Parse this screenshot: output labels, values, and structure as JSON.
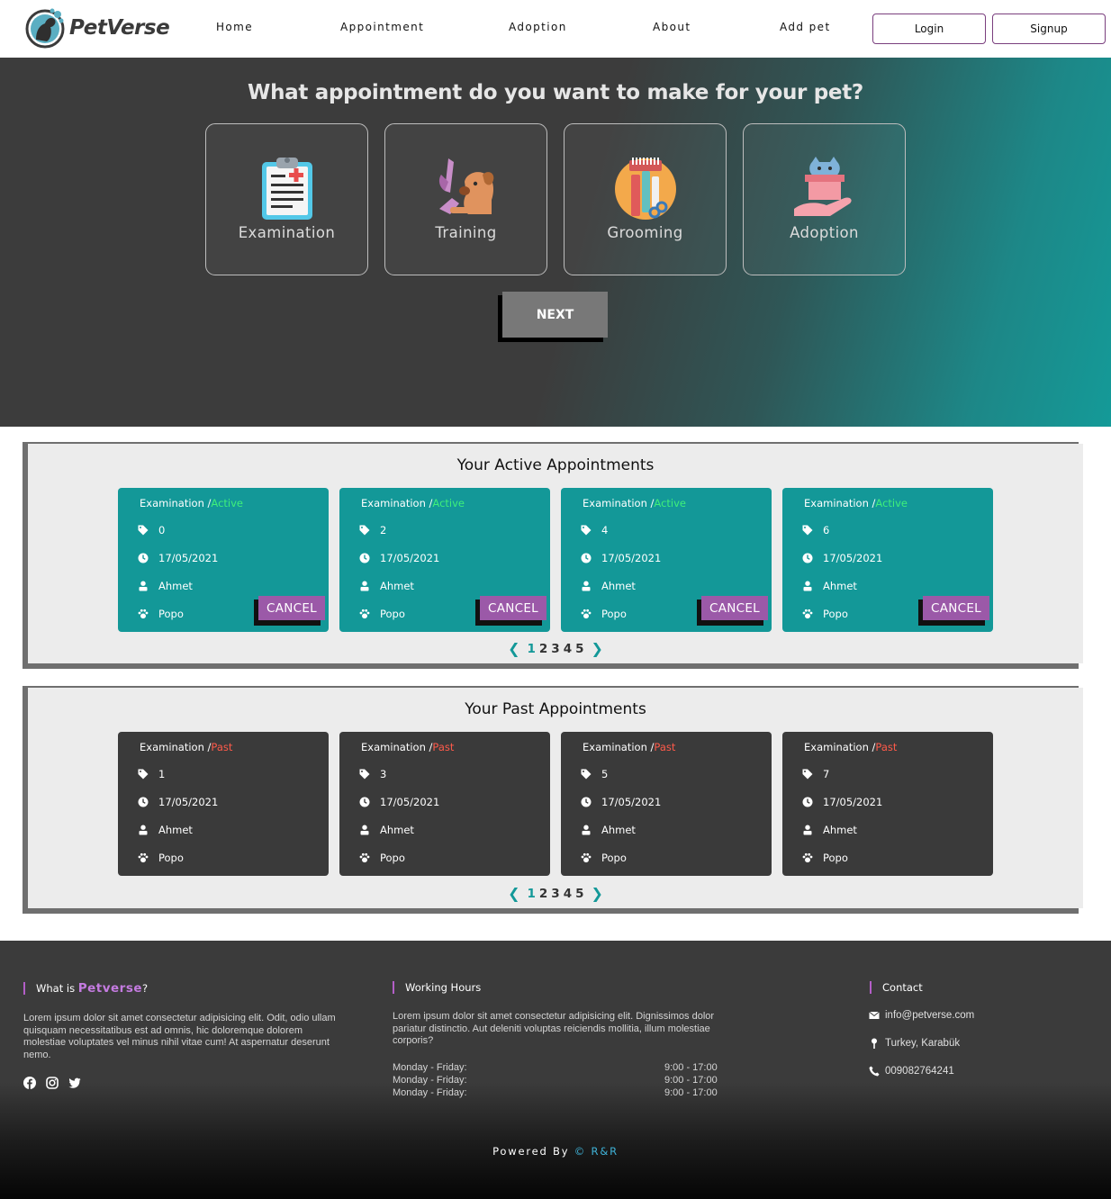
{
  "nav": {
    "brand": "PetVerse",
    "links": [
      "Home",
      "Appointment",
      "Adoption",
      "About",
      "Add pet"
    ],
    "login_label": "Login",
    "signup_label": "Signup"
  },
  "hero": {
    "title": "What appointment do you want to make for your pet?",
    "options": [
      {
        "label": "Examination",
        "icon": "clipboard-medical-icon"
      },
      {
        "label": "Training",
        "icon": "dog-training-icon"
      },
      {
        "label": "Grooming",
        "icon": "grooming-tools-icon"
      },
      {
        "label": "Adoption",
        "icon": "cat-box-hand-icon"
      }
    ],
    "next_label": "NEXT"
  },
  "active_section": {
    "title": "Your Active Appointments",
    "status_label": "Active",
    "cancel_label": "CANCEL",
    "cards": [
      {
        "type": "Examination /",
        "id": "0",
        "date": "17/05/2021",
        "owner": "Ahmet",
        "pet": "Popo"
      },
      {
        "type": "Examination /",
        "id": "2",
        "date": "17/05/2021",
        "owner": "Ahmet",
        "pet": "Popo"
      },
      {
        "type": "Examination /",
        "id": "4",
        "date": "17/05/2021",
        "owner": "Ahmet",
        "pet": "Popo"
      },
      {
        "type": "Examination /",
        "id": "6",
        "date": "17/05/2021",
        "owner": "Ahmet",
        "pet": "Popo"
      }
    ],
    "pages": [
      "1",
      "2",
      "3",
      "4",
      "5"
    ],
    "current_page": "1"
  },
  "past_section": {
    "title": "Your Past Appointments",
    "status_label": "Past",
    "cards": [
      {
        "type": "Examination /",
        "id": "1",
        "date": "17/05/2021",
        "owner": "Ahmet",
        "pet": "Popo"
      },
      {
        "type": "Examination /",
        "id": "3",
        "date": "17/05/2021",
        "owner": "Ahmet",
        "pet": "Popo"
      },
      {
        "type": "Examination /",
        "id": "5",
        "date": "17/05/2021",
        "owner": "Ahmet",
        "pet": "Popo"
      },
      {
        "type": "Examination /",
        "id": "7",
        "date": "17/05/2021",
        "owner": "Ahmet",
        "pet": "Popo"
      }
    ],
    "pages": [
      "1",
      "2",
      "3",
      "4",
      "5"
    ],
    "current_page": "1"
  },
  "footer": {
    "about_heading_prefix": "What is",
    "about_heading_brand": "Petverse",
    "about_heading_suffix": "?",
    "about_text": "Lorem ipsum dolor sit amet consectetur adipisicing elit. Odit, odio ullam quisquam necessitatibus est ad omnis, hic doloremque dolorem molestiae voluptates vel minus nihil vitae cum! At aspernatur deserunt nemo.",
    "hours_heading": "Working Hours",
    "hours_text": "Lorem ipsum dolor sit amet consectetur adipisicing elit. Dignissimos dolor pariatur distinctio. Aut deleniti voluptas reiciendis mollitia, illum molestiae corporis?",
    "hours": [
      {
        "day": "Monday - Friday:",
        "time": "9:00 - 17:00"
      },
      {
        "day": "Monday - Friday:",
        "time": "9:00 - 17:00"
      },
      {
        "day": "Monday - Friday:",
        "time": "9:00 - 17:00"
      }
    ],
    "contact_heading": "Contact",
    "contact": {
      "email": "info@petverse.com",
      "location": "Turkey, Karabük",
      "phone": "009082764241"
    },
    "powered_prefix": "Powered By",
    "powered_brand": "© R&R"
  },
  "colors": {
    "teal": "#139898",
    "purple": "#9b59a8",
    "active_status": "#3ff07a",
    "past_status": "#ff5a4a",
    "dark": "#3a3a3a"
  }
}
